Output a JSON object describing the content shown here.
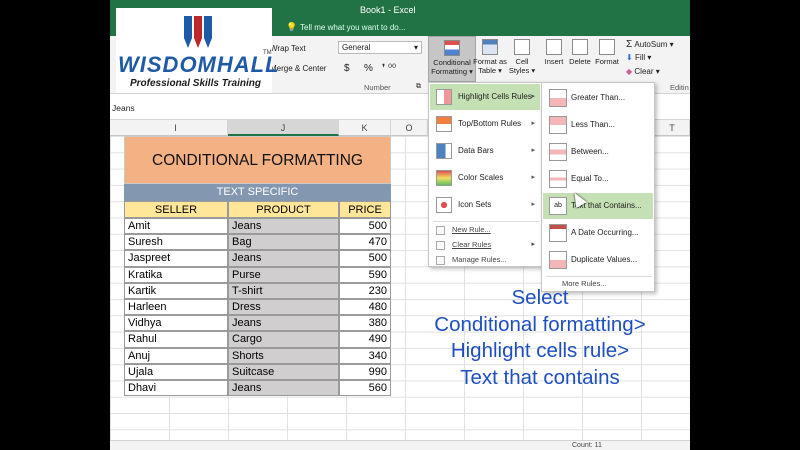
{
  "window": {
    "title": "Book1 - Excel"
  },
  "tell_me": {
    "placeholder": "Tell me what you want to do..."
  },
  "logo": {
    "brand": "WISDOMHALL",
    "tm": "TM",
    "tagline": "Professional Skills Training"
  },
  "ribbon": {
    "wrap_text": "Wrap Text",
    "merge_center": "Merge & Center",
    "number_format": "General",
    "dollar": "$",
    "percent": "%",
    "comma": "▾",
    "number_group": "Number",
    "conditional_formatting": [
      "Conditional",
      "Formatting ▾"
    ],
    "format_as_table": [
      "Format as",
      "Table ▾"
    ],
    "cell_styles": [
      "Cell",
      "Styles ▾"
    ],
    "insert": "Insert",
    "delete": "Delete",
    "format": "Format",
    "autosum": "AutoSum",
    "fill": "Fill ▾",
    "clear": "Clear ▾",
    "editing_group": "Editin"
  },
  "formula_bar": {
    "value": "Jeans"
  },
  "columns": [
    "I",
    "J",
    "K",
    "O",
    "T"
  ],
  "table": {
    "title": "CONDITIONAL FORMATTING",
    "subtitle": "TEXT SPECIFIC",
    "headers": [
      "SELLER",
      "PRODUCT",
      "PRICE"
    ],
    "rows": [
      {
        "seller": "Amit",
        "product": "Jeans",
        "price": "500"
      },
      {
        "seller": "Suresh",
        "product": "Bag",
        "price": "470"
      },
      {
        "seller": "Jaspreet",
        "product": "Jeans",
        "price": "500"
      },
      {
        "seller": "Kratika",
        "product": "Purse",
        "price": "590"
      },
      {
        "seller": "Kartik",
        "product": "T-shirt",
        "price": "230"
      },
      {
        "seller": "Harleen",
        "product": "Dress",
        "price": "480"
      },
      {
        "seller": "Vidhya",
        "product": "Jeans",
        "price": "380"
      },
      {
        "seller": "Rahul",
        "product": "Cargo",
        "price": "490"
      },
      {
        "seller": "Anuj",
        "product": "Shorts",
        "price": "340"
      },
      {
        "seller": "Ujala",
        "product": "Suitcase",
        "price": "990"
      },
      {
        "seller": "Dhavi",
        "product": "Jeans",
        "price": "560"
      }
    ]
  },
  "cf_menu": {
    "items": [
      "Highlight Cells Rules",
      "Top/Bottom Rules",
      "Data Bars",
      "Color Scales",
      "Icon Sets"
    ],
    "small": [
      "New Rule...",
      "Clear Rules",
      "Manage Rules..."
    ]
  },
  "hcr_menu": {
    "items": [
      "Greater Than...",
      "Less Than...",
      "Between...",
      "Equal To...",
      "Text that Contains...",
      "A Date Occurring...",
      "Duplicate Values..."
    ],
    "more": "More Rules..."
  },
  "instruction": [
    "Select",
    "Conditional formatting>",
    "Highlight cells rule>",
    "Text that contains"
  ],
  "status": {
    "count": "Count: 11"
  },
  "colors": {
    "excel_green": "#217346",
    "title_fill": "#f4b183",
    "subtitle_fill": "#8497b0",
    "header_fill": "#ffe699",
    "product_fill": "#d0cece",
    "menu_highlight": "#c5e0b4",
    "instruction_text": "#1e4fc0",
    "logo_blue": "#1f5aa6",
    "logo_red": "#c0272d"
  }
}
